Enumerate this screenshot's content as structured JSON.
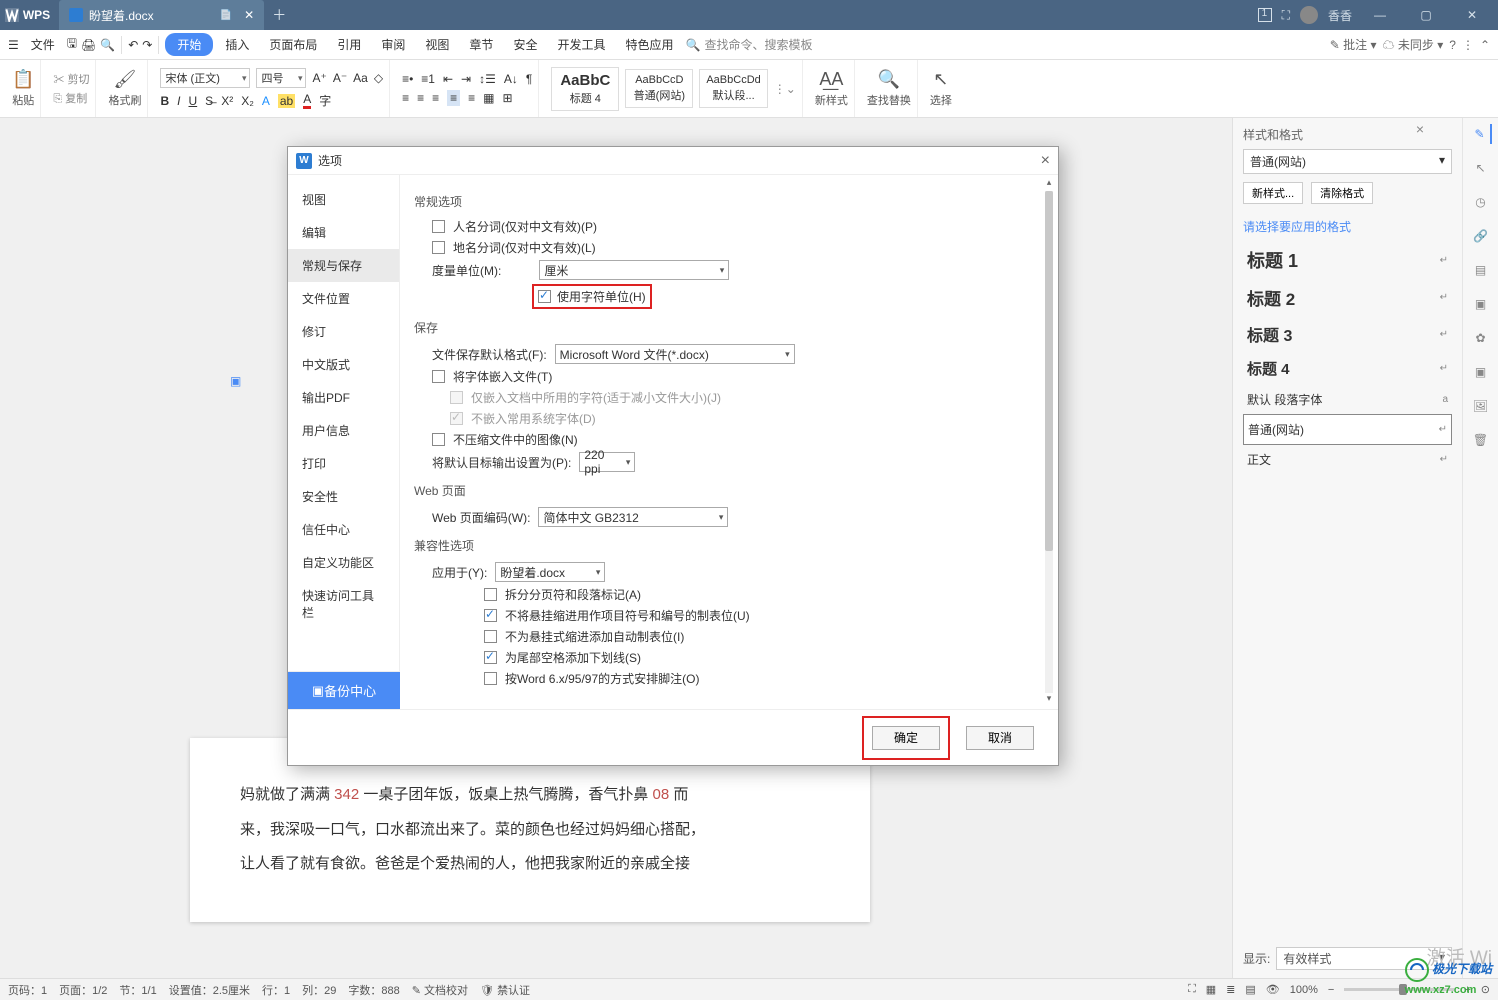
{
  "title": {
    "wps": "WPS",
    "doc": "盼望着.docx"
  },
  "user": "香香",
  "menu": {
    "file": "文件",
    "start": "开始",
    "insert": "插入",
    "layout": "页面布局",
    "ref": "引用",
    "review": "审阅",
    "view": "视图",
    "chapter": "章节",
    "safe": "安全",
    "dev": "开发工具",
    "special": "特色应用",
    "search": "查找命令、搜索模板",
    "comment": "批注",
    "sync": "未同步"
  },
  "ribbon": {
    "paste": "粘贴",
    "cut": "剪切",
    "copy": "复制",
    "brush": "格式刷",
    "font": "宋体 (正文)",
    "size": "四号",
    "styles": {
      "s1": {
        "p": "AaBbC",
        "l": "标题 4"
      },
      "s2": {
        "p": "AaBbCcD",
        "l": "普通(网站)"
      },
      "s3": {
        "p": "AaBbCcDd",
        "l": "默认段..."
      }
    },
    "newstyle": "新样式",
    "findrep": "查找替换",
    "select": "选择"
  },
  "panel": {
    "title": "样式和格式",
    "current": "普通(网站)",
    "new": "新样式...",
    "clear": "清除格式",
    "hint": "请选择要应用的格式",
    "h1": "标题 1",
    "h2": "标题 2",
    "h3": "标题 3",
    "h4": "标题 4",
    "default": "默认 段落字体",
    "normal": "普通(网站)",
    "body": "正文",
    "show": "显示:",
    "effective": "有效样式",
    "a": "a"
  },
  "dialog": {
    "title": "选项",
    "nav": {
      "view": "视图",
      "edit": "编辑",
      "general": "常规与保存",
      "fileloc": "文件位置",
      "rev": "修订",
      "cjk": "中文版式",
      "pdf": "输出PDF",
      "user": "用户信息",
      "print": "打印",
      "sec": "安全性",
      "trust": "信任中心",
      "custom": "自定义功能区",
      "quick": "快速访问工具栏"
    },
    "backup": "备份中心",
    "sec_general": "常规选项",
    "personname": "人名分词(仅对中文有效)(P)",
    "placename": "地名分词(仅对中文有效)(L)",
    "unit_lbl": "度量单位(M):",
    "unit_val": "厘米",
    "usechar": "使用字符单位(H)",
    "sec_save": "保存",
    "saveformat_lbl": "文件保存默认格式(F):",
    "saveformat_val": "Microsoft Word 文件(*.docx)",
    "embedfont": "将字体嵌入文件(T)",
    "embed_used": "仅嵌入文档中所用的字符(适于减小文件大小)(J)",
    "embed_sys": "不嵌入常用系统字体(D)",
    "nocompress": "不压缩文件中的图像(N)",
    "defaultout_lbl": "将默认目标输出设置为(P):",
    "defaultout_val": "220 ppi",
    "sec_web": "Web 页面",
    "webenc_lbl": "Web 页面编码(W):",
    "webenc_val": "简体中文 GB2312",
    "sec_compat": "兼容性选项",
    "apply_lbl": "应用于(Y):",
    "apply_val": "盼望着.docx",
    "c1": "拆分分页符和段落标记(A)",
    "c2": "不将悬挂缩进用作项目符号和编号的制表位(U)",
    "c3": "不为悬挂式缩进添加自动制表位(I)",
    "c4": "为尾部空格添加下划线(S)",
    "c5": "按Word 6.x/95/97的方式安排脚注(O)",
    "ok": "确定",
    "cancel": "取消"
  },
  "doc_text": {
    "l1a": "妈就做了满满 ",
    "l1n": "342",
    "l1b": " 一桌子团年饭，饭桌上热气腾腾，香气扑鼻 ",
    "l1n2": "08",
    "l1c": " 而",
    "l2": "来，我深吸一口气，口水都流出来了。菜的颜色也经过妈妈细心搭配，",
    "l3": "让人看了就有食欲。爸爸是个爱热闹的人，他把我家附近的亲戚全接"
  },
  "status": {
    "page": "页码：1",
    "pages": "页面：1/2",
    "sec": "节：1/1",
    "setting": "设置值：2.5厘米",
    "row": "行：1",
    "col": "列：29",
    "words": "字数：888",
    "proof": "文档校对",
    "deny": "禁认证",
    "zoom": "100%"
  },
  "watermark": "激活 Wi",
  "brand": {
    "a": "极光下载站",
    "b": "www.xz7.com"
  }
}
